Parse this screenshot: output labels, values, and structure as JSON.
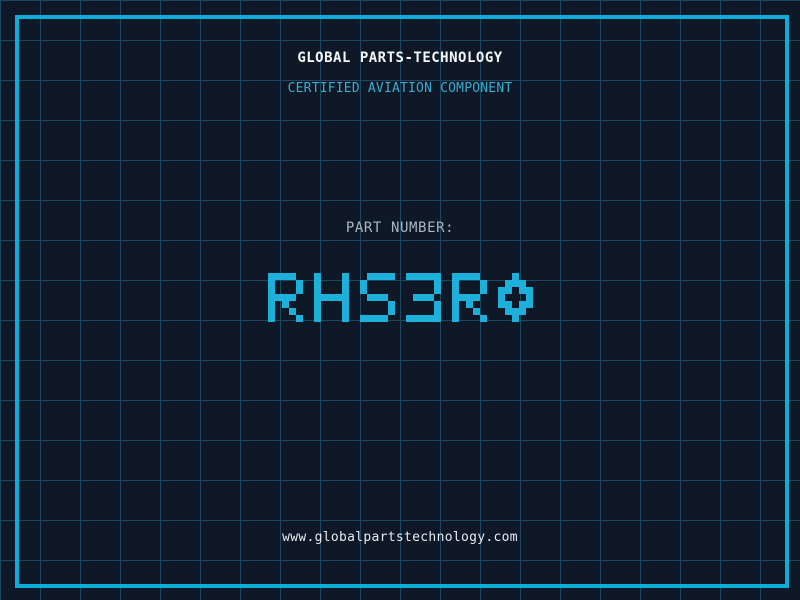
{
  "brand": {
    "title": "GLOBAL PARTS-TECHNOLOGY",
    "subtitle": "CERTIFIED AVIATION COMPONENT"
  },
  "part": {
    "label": "PART NUMBER:",
    "number": "RHS3R0"
  },
  "footer": {
    "url": "www.globalpartstechnology.com"
  },
  "colors": {
    "background": "#0f1827",
    "grid_line": "#184a61",
    "frame": "#0caed9",
    "title_text": "#f5f7f8",
    "subtitle_text": "#38add2",
    "label_text": "#a9b7c1",
    "part_number_text": "#1cb0da",
    "footer_text": "#e4ebf0"
  }
}
